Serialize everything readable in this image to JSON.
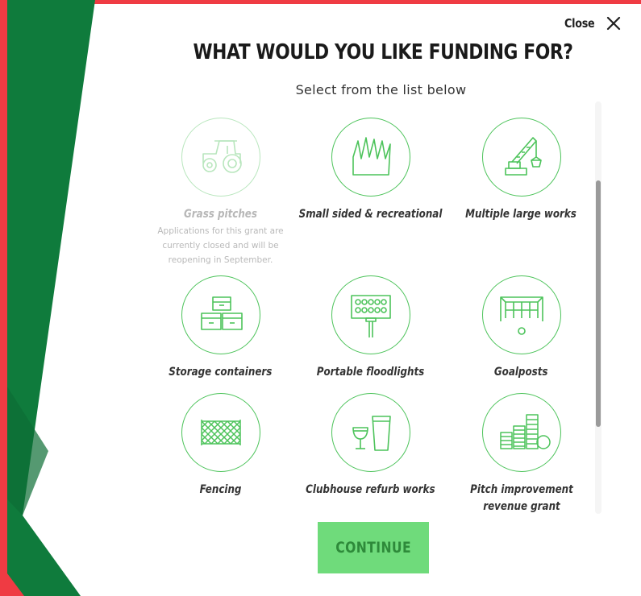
{
  "header": {
    "close_label": "Close",
    "title": "WHAT WOULD YOU LIKE FUNDING FOR?",
    "subtitle": "Select from the list below"
  },
  "options": [
    {
      "label": "Grass pitches",
      "icon": "tractor-icon",
      "disabled": true,
      "note": "Applications for this grant are currently closed and will be reopening in September."
    },
    {
      "label": "Small sided & recreational",
      "icon": "artificial-grass-icon",
      "disabled": false
    },
    {
      "label": "Multiple large works",
      "icon": "crane-icon",
      "disabled": false
    },
    {
      "label": "Storage containers",
      "icon": "storage-boxes-icon",
      "disabled": false
    },
    {
      "label": "Portable floodlights",
      "icon": "floodlight-icon",
      "disabled": false
    },
    {
      "label": "Goalposts",
      "icon": "goalpost-icon",
      "disabled": false
    },
    {
      "label": "Fencing",
      "icon": "fence-icon",
      "disabled": false
    },
    {
      "label": "Clubhouse refurb works",
      "icon": "glasses-icon",
      "disabled": false
    },
    {
      "label": "Pitch improvement revenue grant",
      "icon": "coin-stacks-icon",
      "disabled": false
    }
  ],
  "footer": {
    "continue_label": "CONTINUE"
  },
  "colors": {
    "brand_green": "#0f7b3c",
    "accent_red": "#ef3b43",
    "icon_green": "#4cc35a",
    "button_green": "#6fdb7b"
  }
}
